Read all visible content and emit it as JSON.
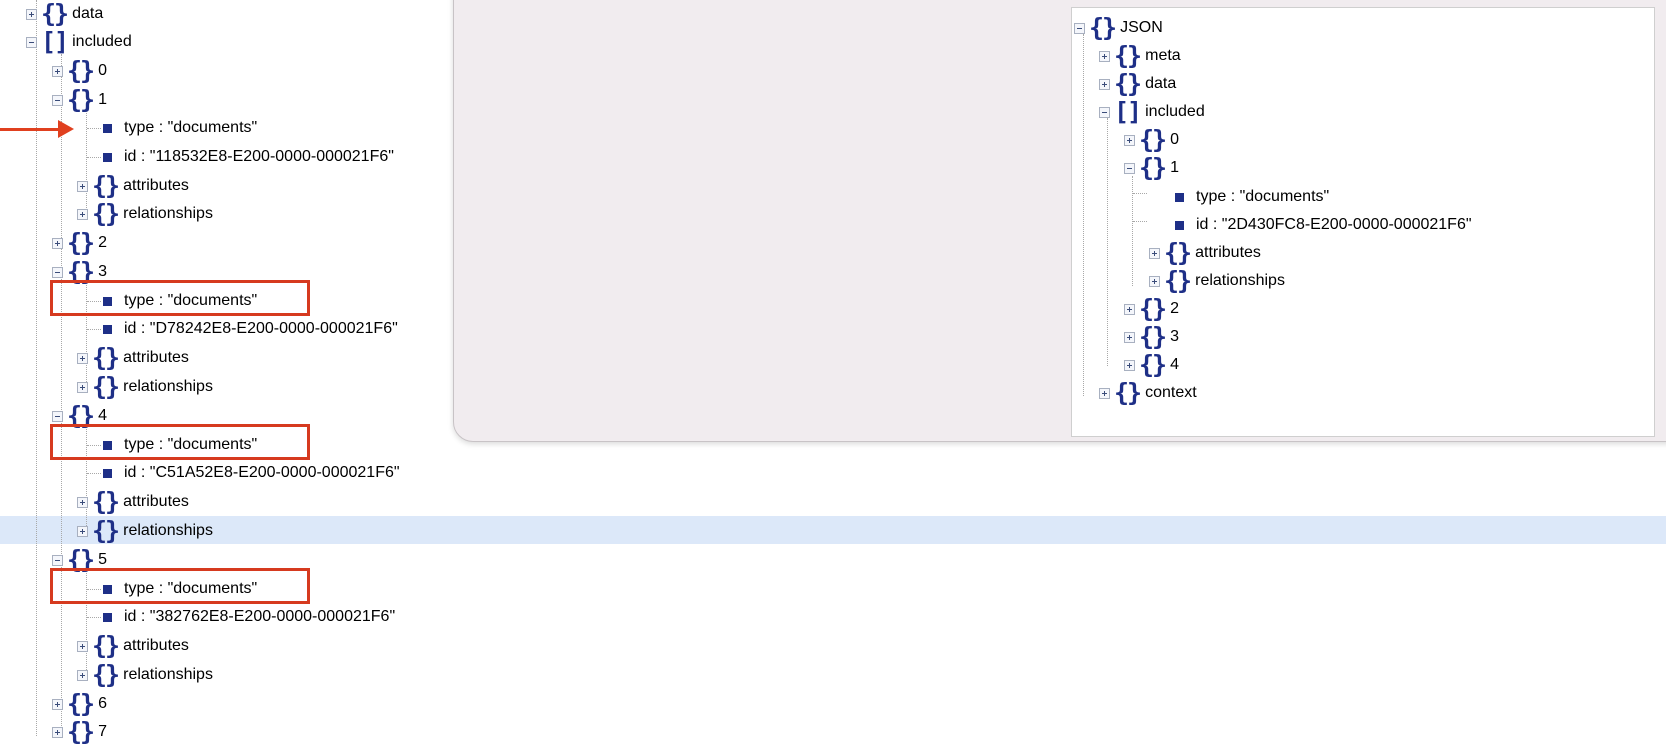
{
  "left_tree": {
    "data": "data",
    "included": "included",
    "item_0": "0",
    "item_1": "1",
    "item_1_type": "type : \"documents\"",
    "item_1_id": "id : \"118532E8-E200-0000-000021F6\"",
    "item_1_attributes": "attributes",
    "item_1_relationships": "relationships",
    "item_2": "2",
    "item_3": "3",
    "item_3_type": "type : \"documents\"",
    "item_3_id": "id : \"D78242E8-E200-0000-000021F6\"",
    "item_3_attributes": "attributes",
    "item_3_relationships": "relationships",
    "item_4": "4",
    "item_4_type": "type : \"documents\"",
    "item_4_id": "id : \"C51A52E8-E200-0000-000021F6\"",
    "item_4_attributes": "attributes",
    "item_4_relationships": "relationships",
    "item_5": "5",
    "item_5_type": "type : \"documents\"",
    "item_5_id": "id : \"382762E8-E200-0000-000021F6\"",
    "item_5_attributes": "attributes",
    "item_5_relationships": "relationships",
    "item_6": "6",
    "item_7": "7"
  },
  "right_tree": {
    "root": "JSON",
    "meta": "meta",
    "data": "data",
    "included": "included",
    "item_0": "0",
    "item_1": "1",
    "item_1_type": "type : \"documents\"",
    "item_1_id": "id : \"2D430FC8-E200-0000-000021F6\"",
    "item_1_attributes": "attributes",
    "item_1_relationships": "relationships",
    "item_2": "2",
    "item_3": "3",
    "item_4": "4",
    "context": "context"
  },
  "icons": {
    "object": "{}",
    "array": "[]",
    "expand": "plus-box-icon",
    "collapse": "minus-box-icon",
    "leaf": "square-bullet-icon",
    "annotation_arrow": "red-arrow-icon"
  },
  "colors": {
    "glyph": "#1e2f87",
    "highlight_row": "#dce8f9",
    "annotation": "#d63a1f",
    "overlay_bg": "#f1ecef"
  }
}
